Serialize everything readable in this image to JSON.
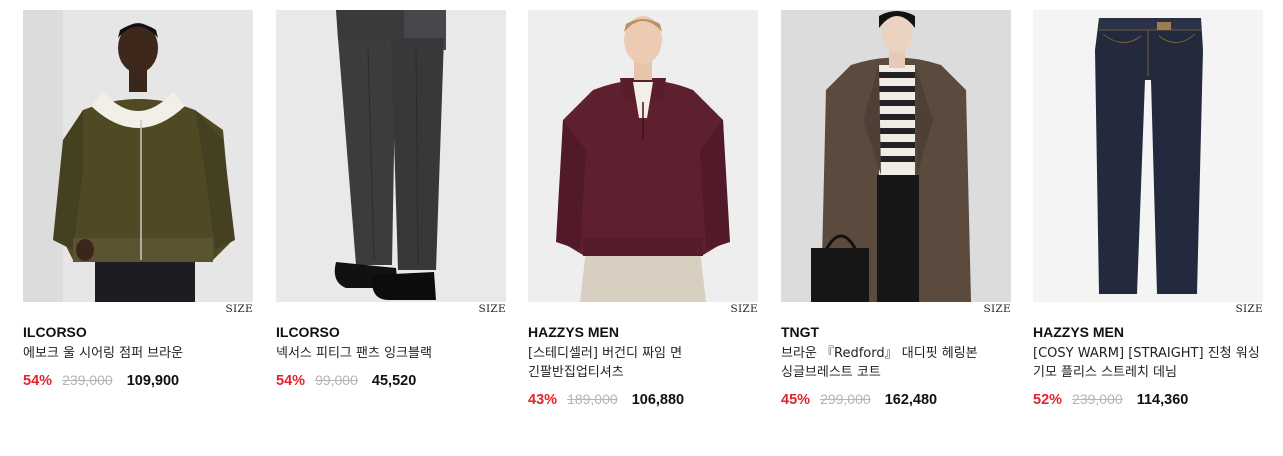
{
  "products": [
    {
      "image_alt": "ILCORSO jacket model",
      "size_label": "SIZE",
      "brand": "ILCORSO",
      "name": "에보크 울 시어링 점퍼 브라운",
      "discount": "54%",
      "original_price": "239,000",
      "price": "109,900",
      "colors": {
        "bg": "#e7e6e6",
        "main": "#4f4a23"
      }
    },
    {
      "image_alt": "ILCORSO pants model",
      "size_label": "SIZE",
      "brand": "ILCORSO",
      "name": "넥서스 피티그 팬츠 잉크블랙",
      "discount": "54%",
      "original_price": "99,000",
      "price": "45,520",
      "colors": {
        "bg": "#e9e9ea",
        "main": "#3b3c3e"
      }
    },
    {
      "image_alt": "HAZZYS MEN half zip model",
      "size_label": "SIZE",
      "brand": "HAZZYS MEN",
      "name": "[스테디셀러] 버건디 짜임 면 긴팔반집업티셔츠",
      "discount": "43%",
      "original_price": "189,000",
      "price": "106,880",
      "colors": {
        "bg": "#eeeeef",
        "main": "#5e1f2e"
      }
    },
    {
      "image_alt": "TNGT coat model",
      "size_label": "SIZE",
      "brand": "TNGT",
      "name": "브라운 『Redford』 대디핏 헤링본 싱글브레스트 코트",
      "discount": "45%",
      "original_price": "299,000",
      "price": "162,480",
      "colors": {
        "bg": "#dcdcdd",
        "main": "#5b4b3f"
      }
    },
    {
      "image_alt": "HAZZYS MEN denim",
      "size_label": "SIZE",
      "brand": "HAZZYS MEN",
      "name": "[COSY WARM] [STRAIGHT] 진청 워싱 기모 플리스 스트레치 데님",
      "discount": "52%",
      "original_price": "239,000",
      "price": "114,360",
      "colors": {
        "bg": "#f4f4f4",
        "main": "#232a3d"
      }
    }
  ]
}
